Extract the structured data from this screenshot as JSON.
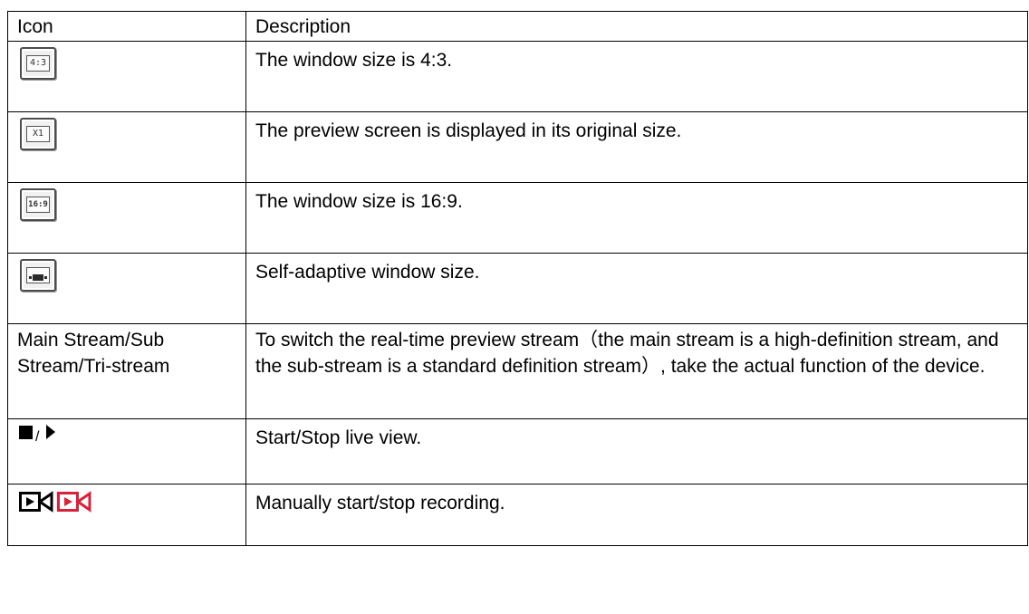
{
  "table": {
    "header": {
      "icon": "Icon",
      "description": "Description"
    },
    "rows": [
      {
        "icon_name": "ratio-4-3-icon",
        "icon_text": "4:3",
        "description": "The window size is 4:3."
      },
      {
        "icon_name": "original-size-icon",
        "icon_text": "X1",
        "description": "The preview screen is displayed in its original size."
      },
      {
        "icon_name": "ratio-16-9-icon",
        "icon_text": "16:9",
        "description": "The window size is 16:9."
      },
      {
        "icon_name": "self-adaptive-icon",
        "description": "Self-adaptive window size."
      },
      {
        "icon_label": "Main Stream/Sub Stream/Tri-stream",
        "description": "To switch the real-time preview stream（the main stream is a high-definition stream, and the sub-stream is a standard definition stream）, take the actual function of the device."
      },
      {
        "icon_name": "stop-play-icons",
        "icon_separator": "/",
        "description": "Start/Stop live view."
      },
      {
        "icon_name": "record-icons",
        "description": "Manually start/stop recording."
      }
    ]
  },
  "colors": {
    "border": "#000000",
    "record_active": "#d9213a",
    "icon_button_bg": "#f1f1f1"
  }
}
